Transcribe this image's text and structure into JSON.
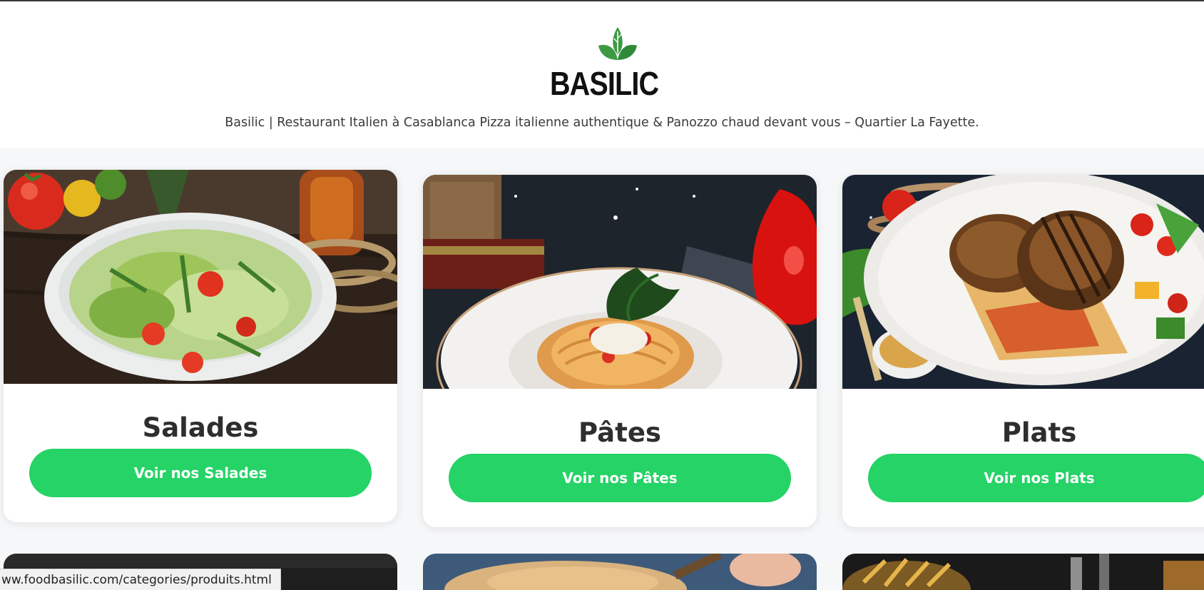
{
  "header": {
    "brand": "BASILIC",
    "tagline": "Basilic | Restaurant Italien à Casablanca Pizza italienne authentique & Panozzo chaud devant vous – Quartier La Fayette.",
    "logo_icon": "basil-leaf-icon",
    "accent_color": "#2e8b3a"
  },
  "categories": [
    {
      "title": "Salades",
      "button": "Voir nos Salades",
      "image": "salad-bowl-photo"
    },
    {
      "title": "Pâtes",
      "button": "Voir nos Pâtes",
      "image": "spaghetti-plate-photo"
    },
    {
      "title": "Plats",
      "button": "Voir nos Plats",
      "image": "grilled-chicken-plate-photo"
    }
  ],
  "button_color": "#25d366",
  "status_bar": {
    "url": "ww.foodbasilic.com/categories/produits.html"
  }
}
